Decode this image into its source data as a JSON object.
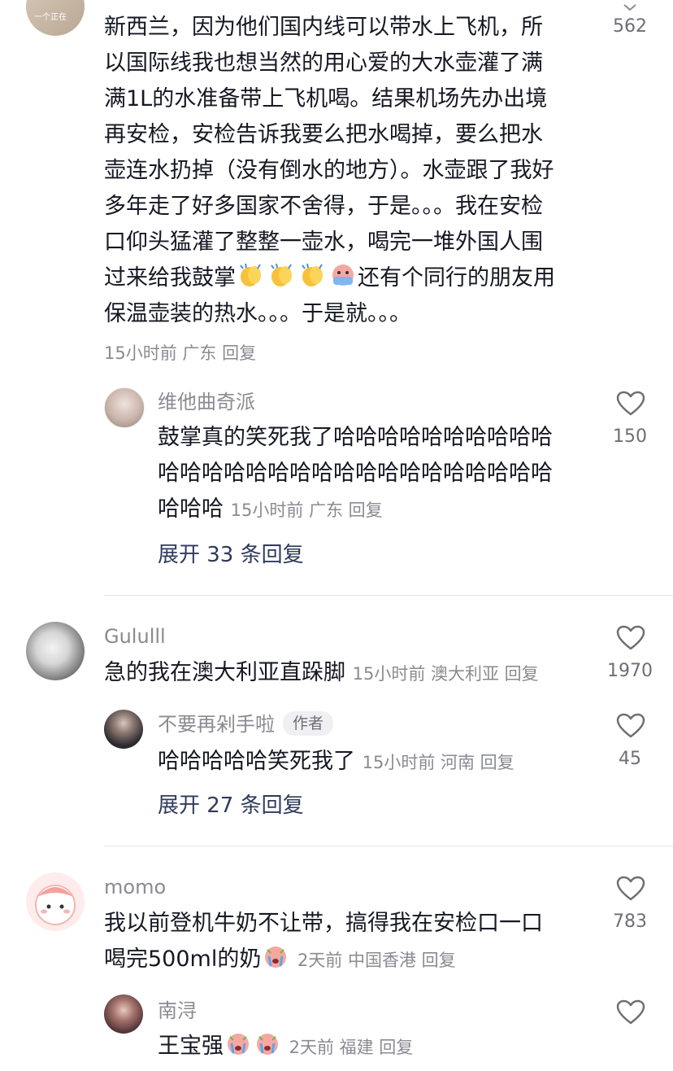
{
  "comments": [
    {
      "text_lines": [
        "新西兰，因为他们国内线可以带水上飞机，所",
        "以国际线我也想当然的用心爱的大水壶灌了满",
        "满1L的水准备带上飞机喝。结果机场先办出境",
        "再安检，安检告诉我要么把水喝掉，要么把水",
        "壶连水扔掉（没有倒水的地方）。水壶跟了我好",
        "多年走了好多国家不舍得，于是。。。我在安检",
        "口仰头猛灌了整整一壶水，喝完一堆外国人围"
      ],
      "line8_pre": "过来给我鼓掌",
      "line8_post": "还有个同行的朋友用",
      "line9": "保温壶装的热水。。。于是就。。。",
      "meta": "15小时前 广东 回复",
      "likes": "562",
      "avatar_text": "一个正在"
    },
    {
      "user": "维他曲奇派",
      "text_lines": [
        "鼓掌真的笑死我了哈哈哈哈哈哈哈哈哈哈",
        "哈哈哈哈哈哈哈哈哈哈哈哈哈哈哈哈哈哈"
      ],
      "last": "哈哈哈",
      "meta": "15小时前 广东 回复",
      "likes": "150",
      "expand": "展开 33 条回复"
    },
    {
      "user": "Gululll",
      "text": "急的我在澳大利亚直跺脚",
      "meta": "15小时前 澳大利亚 回复",
      "likes": "1970"
    },
    {
      "user": "不要再剁手啦",
      "badge": "作者",
      "text": "哈哈哈哈哈笑死我了",
      "meta": "15小时前 河南 回复",
      "likes": "45",
      "expand": "展开 27 条回复"
    },
    {
      "user": "momo",
      "text_lines": [
        "我以前登机牛奶不让带，搞得我在安检口一口"
      ],
      "line2": "喝完500ml的奶",
      "meta": "2天前 中国香港 回复",
      "likes": "783"
    },
    {
      "user": "南浔",
      "text": "王宝强",
      "meta": "2天前 福建 回复",
      "likes": ""
    }
  ],
  "icons": {
    "like": "heart-outline-icon",
    "clap": "clapping-hands-emoji",
    "cry": "crying-face-emoji"
  },
  "colors": {
    "text": "#161823",
    "meta": "#8a8b91",
    "expand": "#2f3b5c"
  }
}
